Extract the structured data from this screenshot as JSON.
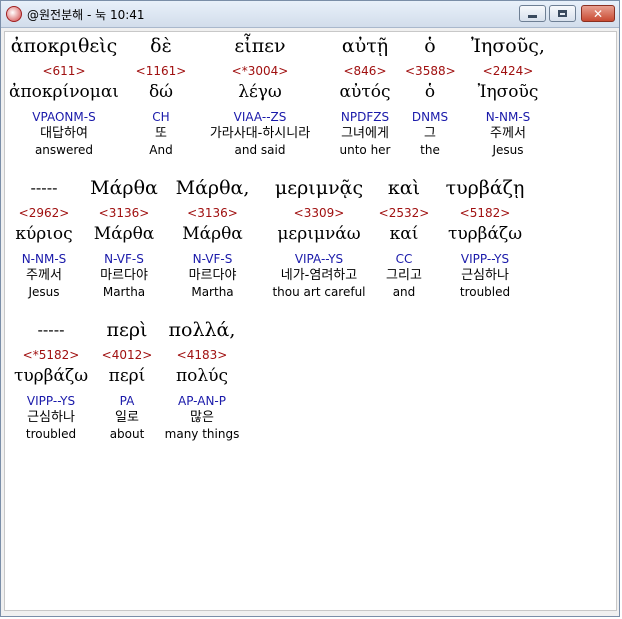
{
  "window": {
    "title": "@원전분해 - 눅 10:41",
    "min_label": "minimize",
    "max_label": "maximize",
    "close_label": "close"
  },
  "rows": [
    {
      "words": [
        {
          "greek": "ἀποκριθεὶς",
          "strong": "<611>",
          "lemma": "ἀποκρίνομαι",
          "parse": "VPAONM-S",
          "korean": "대답하여",
          "english": "answered"
        },
        {
          "greek": "δὲ",
          "strong": "<1161>",
          "lemma": "δώ",
          "parse": "CH",
          "korean": "또",
          "english": "And"
        },
        {
          "greek": "εἶπεν",
          "strong": "<*3004>",
          "lemma": "λέγω",
          "parse": "VIAA--ZS",
          "korean": "가라사대-하시니라",
          "english": "and said"
        },
        {
          "greek": "αὐτῇ",
          "strong": "<846>",
          "lemma": "αὐτός",
          "parse": "NPDFZS",
          "korean": "그녀에게",
          "english": "unto her"
        },
        {
          "greek": "ὁ",
          "strong": "<3588>",
          "lemma": "ὁ",
          "parse": "DNMS",
          "korean": "그",
          "english": "the"
        },
        {
          "greek": "Ἰησοῦς,",
          "strong": "<2424>",
          "lemma": "Ἰησοῦς",
          "parse": "N-NM-S",
          "korean": "주께서",
          "english": "Jesus"
        }
      ]
    },
    {
      "words": [
        {
          "greek": "-----",
          "strong": "<2962>",
          "lemma": "κύριος",
          "parse": "N-NM-S",
          "korean": "주께서",
          "english": "Jesus"
        },
        {
          "greek": "Μάρθα",
          "strong": "<3136>",
          "lemma": "Μάρθα",
          "parse": "N-VF-S",
          "korean": "마르다야",
          "english": "Martha"
        },
        {
          "greek": "Μάρθα,",
          "strong": "<3136>",
          "lemma": "Μάρθα",
          "parse": "N-VF-S",
          "korean": "마르다야",
          "english": "Martha"
        },
        {
          "greek": "μεριμνᾷς",
          "strong": "<3309>",
          "lemma": "μεριμνάω",
          "parse": "VIPA--YS",
          "korean": "네가-염려하고",
          "english": "thou art careful"
        },
        {
          "greek": "καὶ",
          "strong": "<2532>",
          "lemma": "καί",
          "parse": "CC",
          "korean": "그리고",
          "english": "and"
        },
        {
          "greek": "τυρβάζῃ",
          "strong": "<5182>",
          "lemma": "τυρβάζω",
          "parse": "VIPP--YS",
          "korean": "근심하나",
          "english": "troubled"
        }
      ]
    },
    {
      "words": [
        {
          "greek": "-----",
          "strong": "<*5182>",
          "lemma": "τυρβάζω",
          "parse": "VIPP--YS",
          "korean": "근심하나",
          "english": "troubled"
        },
        {
          "greek": "περὶ",
          "strong": "<4012>",
          "lemma": "περί",
          "parse": "PA",
          "korean": "일로",
          "english": "about"
        },
        {
          "greek": "πολλά,",
          "strong": "<4183>",
          "lemma": "πολύς",
          "parse": "AP-AN-P",
          "korean": "많은",
          "english": "many things"
        }
      ]
    }
  ]
}
